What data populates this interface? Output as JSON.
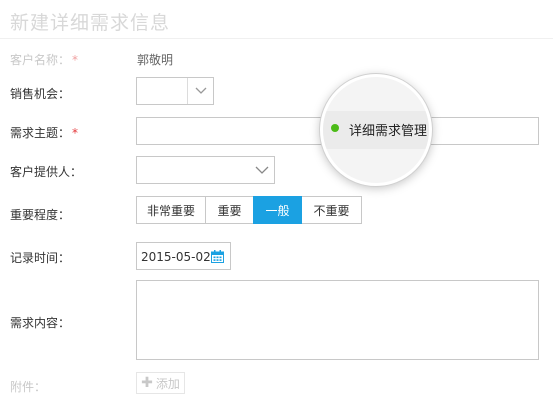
{
  "header": {
    "title": "新建详细需求信息"
  },
  "form": {
    "customer_name": {
      "label": "客户名称：",
      "required": "*",
      "value": "郭敬明"
    },
    "sales_opportunity": {
      "label": "销售机会：",
      "value": ""
    },
    "requirement_subject": {
      "label": "需求主题：",
      "required": "*",
      "value": ""
    },
    "customer_provider": {
      "label": "客户提供人：",
      "value": ""
    },
    "importance": {
      "label": "重要程度：",
      "options": [
        "非常重要",
        "重要",
        "一般",
        "不重要"
      ],
      "selected": "一般"
    },
    "record_time": {
      "label": "记录时间：",
      "value": "2015-05-02"
    },
    "requirement_content": {
      "label": "需求内容：",
      "value": ""
    },
    "attachment": {
      "label": "附件：",
      "add_label": "添加"
    }
  },
  "magnifier": {
    "label": "详细需求管理",
    "dot_color": "#4cbb17"
  },
  "colors": {
    "accent": "#1ba1e2",
    "required": "#e4393c"
  }
}
